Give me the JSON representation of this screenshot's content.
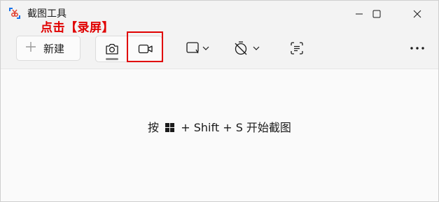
{
  "window": {
    "title": "截图工具"
  },
  "annotation": {
    "text": "点击【录屏】"
  },
  "toolbar": {
    "new_label": "新建",
    "icons": {
      "new": "plus-icon",
      "screenshot_mode": "camera-icon",
      "record_mode": "video-camera-icon",
      "snip_shape": "rectangle-snip-icon",
      "delay": "timer-off-icon",
      "text_actions": "text-scan-icon",
      "more": "more-horizontal-icon"
    }
  },
  "content": {
    "hint_prefix": "按",
    "hint_key_icon": "windows-key-icon",
    "hint_suffix": "+ Shift + S 开始截图"
  },
  "colors": {
    "annotation": "#e00000",
    "background": "#f3f3f3",
    "content_bg": "#fafafa"
  }
}
